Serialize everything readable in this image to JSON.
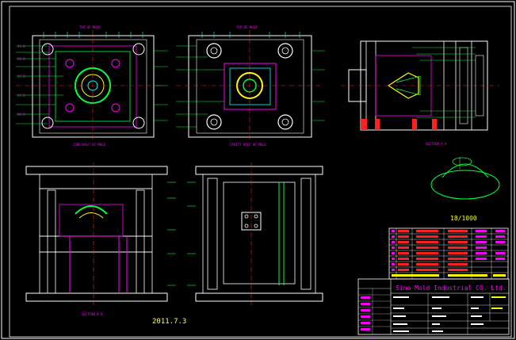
{
  "views": {
    "core_half_title": "TOP OF MOLD",
    "core_half_caption": "CORE HALF OF MOLD",
    "cavity_top_title": "TOP OF MOLD",
    "cavity_half_caption": "CAVITY HALF OF MOLD",
    "section_aa_caption": "SECTION A-A",
    "section_bb_caption": "SECTION B-B",
    "scale_label": "18/1000"
  },
  "date_stamp": "2011.7.3",
  "title_block": {
    "company": "Sino-Mold Industrial CO. Ltd."
  },
  "colors": {
    "frame": "#ffffff",
    "green": "#00ff3c",
    "magenta": "#ff00ff",
    "cyan": "#00ffff",
    "yellow": "#ffff00",
    "red": "#ff2020",
    "blue": "#3a5bff",
    "date": "#ffff40"
  }
}
